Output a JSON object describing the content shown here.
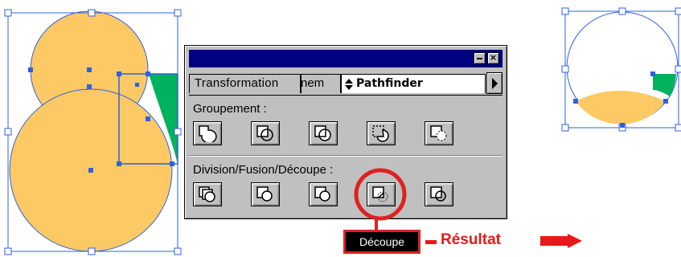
{
  "palette": {
    "window_buttons": {
      "minimize": "minimize",
      "close": "×"
    },
    "tabs": [
      {
        "label": "Transformation",
        "active": false
      },
      {
        "label": "Alignement",
        "visible_text": "nem",
        "active": false
      },
      {
        "label": "Pathfinder",
        "active": true
      }
    ],
    "groups": [
      {
        "label": "Groupement :",
        "buttons": [
          "unite-icon",
          "intersect-icon",
          "exclude-icon",
          "minus-front-icon",
          "minus-back-icon"
        ]
      },
      {
        "label": "Division/Fusion/Découpe :",
        "buttons": [
          "divide-icon",
          "trim-icon",
          "merge-icon",
          "crop-icon",
          "outline-icon"
        ]
      }
    ],
    "highlighted_button": "crop-icon"
  },
  "tooltip": {
    "text": "Découpe"
  },
  "annotation": {
    "result_label": "Résultat"
  },
  "colors": {
    "shape_fill": "#fcc965",
    "cut_fill": "#00b25d",
    "selection": "#3060e0",
    "palette_title": "#000080",
    "palette_body": "#c0c0c0",
    "highlight": "#dd2222",
    "annotation": "#e8181a"
  }
}
